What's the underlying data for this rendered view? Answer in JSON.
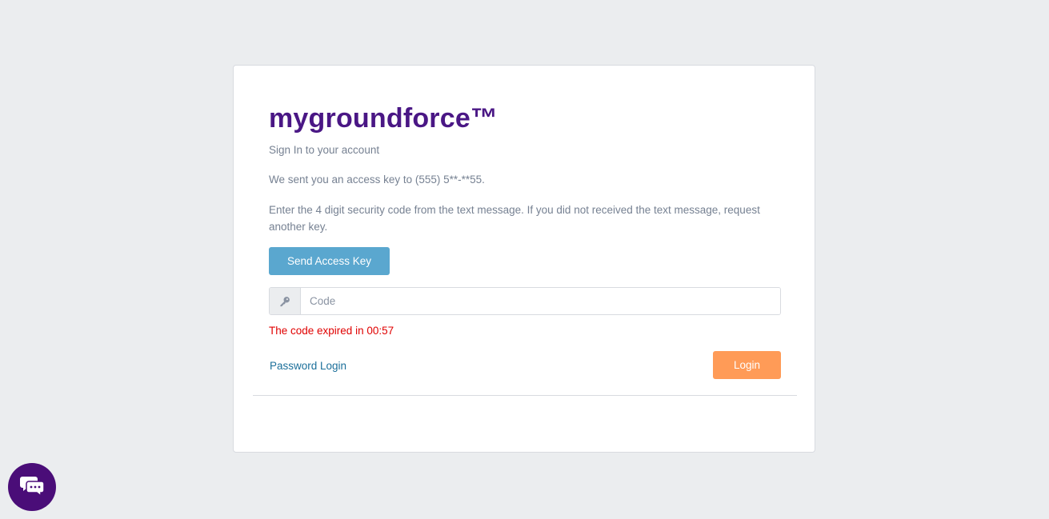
{
  "brand": {
    "name": "mygroundforce™"
  },
  "login": {
    "subtitle": "Sign In to your account",
    "sent_message": "We sent you an access key to (555) 5**-**55.",
    "instructions": "Enter the 4 digit security code from the text message. If you did not received the text message, request another key.",
    "send_key_label": "Send Access Key",
    "code_placeholder": "Code",
    "code_value": "",
    "expiry_message": "The code expired in 00:57",
    "password_login_label": "Password Login",
    "login_label": "Login"
  },
  "icons": {
    "input_prepend": "key-icon",
    "chat_widget": "chat-bubbles-icon"
  },
  "colors": {
    "brand": "#4a1785",
    "send_button": "#5aa7cf",
    "login_button": "#ff9b57",
    "error_text": "#e00000",
    "link": "#1b6f9a",
    "chat_widget": "#4a0d78"
  }
}
